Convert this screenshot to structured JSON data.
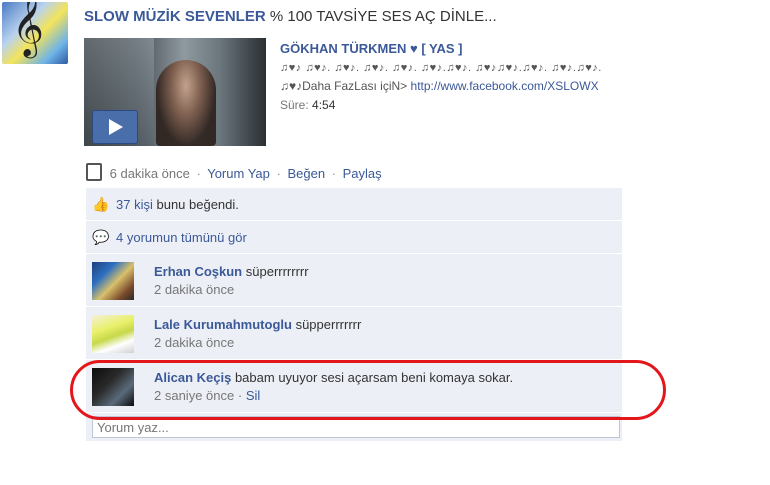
{
  "post": {
    "page_name": "SLOW MÜZİK SEVENLER",
    "message": "% 100 TAVSİYE SES AÇ DİNLE..."
  },
  "video": {
    "title": "GÖKHAN TÜRKMEN ♥ [ YAS ]",
    "desc_line1": "♫♥♪ ♫♥♪. ♫♥♪. ♫♥♪. ♫♥♪. ♫♥♪.♫♥♪. ♫♥♪♫♥♪.♫♥♪. ♫♥♪.♫♥♪.",
    "desc_line2_prefix": "♫♥♪Daha FazLası içiN>",
    "desc_link": "http://www.facebook.com/XSLOWX",
    "duration_label": "Süre:",
    "duration_value": "4:54"
  },
  "actions": {
    "time": "6 dakika önce",
    "comment": "Yorum Yap",
    "like": "Beğen",
    "share": "Paylaş",
    "separator": "·"
  },
  "likes": {
    "count_link": "37 kişi",
    "suffix": "bunu beğendi."
  },
  "view_all": "4 yorumun tümünü gör",
  "comments": [
    {
      "name": "Erhan Coşkun",
      "text": "süperrrrrrrr",
      "time": "2 dakika önce"
    },
    {
      "name": "Lale Kurumahmutoglu",
      "text": "süpperrrrrrr",
      "time": "2 dakika önce"
    },
    {
      "name": "Alican Keçiş",
      "text": "babam uyuyor sesi açarsam beni komaya sokar.",
      "time": "2 saniye önce",
      "delete": "Sil"
    }
  ],
  "composer": {
    "placeholder": "Yorum yaz..."
  },
  "colors": {
    "link": "#3b5998",
    "ufi_bg": "#eceff5",
    "highlight": "#e3161b"
  }
}
